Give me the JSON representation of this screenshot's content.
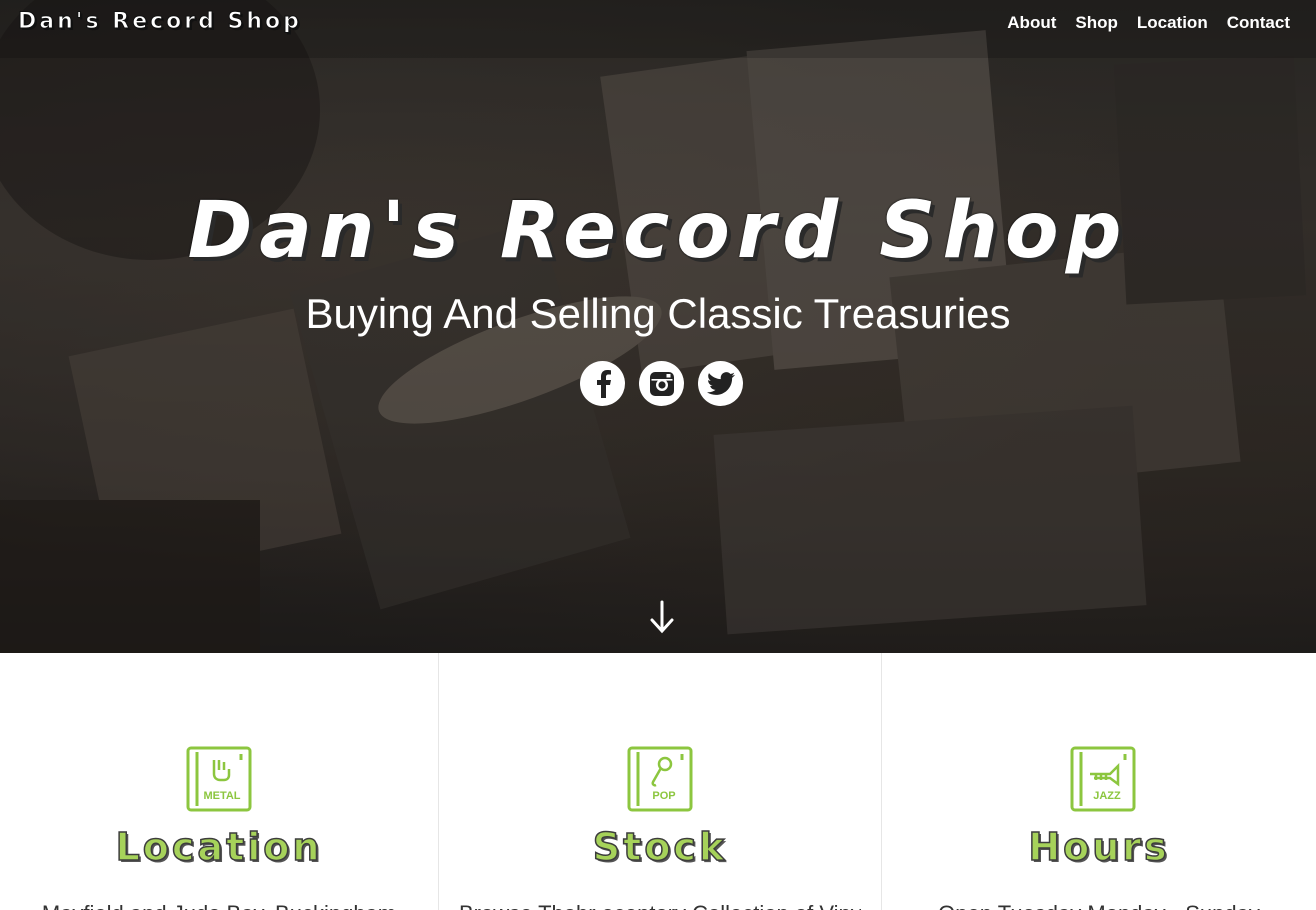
{
  "header": {
    "logo_text": "Dan's Record Shop",
    "nav": [
      {
        "label": "About"
      },
      {
        "label": "Shop"
      },
      {
        "label": "Location"
      },
      {
        "label": "Contact"
      }
    ]
  },
  "hero": {
    "title": "Dan's Record Shop",
    "subtitle": "Buying And Selling Classic Treasuries",
    "social": [
      {
        "name": "facebook-icon"
      },
      {
        "name": "instagram-icon"
      },
      {
        "name": "twitter-icon"
      }
    ],
    "down_icon": "arrow-down-icon"
  },
  "features": [
    {
      "icon": "metal-record-icon",
      "icon_label": "METAL",
      "title": "Location",
      "text": "Mayfield and Judo Bay, Buckingham"
    },
    {
      "icon": "pop-record-icon",
      "icon_label": "POP",
      "title": "Stock",
      "text": "Browse Thobr ecentory Collection of Vinyl"
    },
    {
      "icon": "jazz-record-icon",
      "icon_label": "JAZZ",
      "title": "Hours",
      "text": "Open Tuesday Monday - Sunday"
    }
  ],
  "colors": {
    "accent_green": "#a6d25a",
    "icon_green": "#8cc63f",
    "divider": "#e6e6e6"
  }
}
